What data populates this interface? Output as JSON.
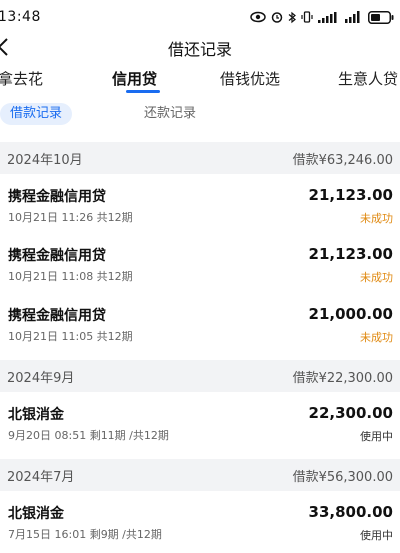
{
  "status_bar": {
    "time": "13:48"
  },
  "nav": {
    "title": "借还记录"
  },
  "product_tabs": [
    {
      "label": "拿去花"
    },
    {
      "label": "信用贷"
    },
    {
      "label": "借钱优选"
    },
    {
      "label": "生意人贷"
    }
  ],
  "subtabs": [
    {
      "label": "借款记录"
    },
    {
      "label": "还款记录"
    }
  ],
  "groups": [
    {
      "month": "2024年10月",
      "total": "借款¥63,246.00",
      "items": [
        {
          "name": "携程金融信用贷",
          "meta": "10月21日 11:26 共12期",
          "amount": "21,123.00",
          "status": "未成功"
        },
        {
          "name": "携程金融信用贷",
          "meta": "10月21日 11:08 共12期",
          "amount": "21,123.00",
          "status": "未成功"
        },
        {
          "name": "携程金融信用贷",
          "meta": "10月21日 11:05 共12期",
          "amount": "21,000.00",
          "status": "未成功"
        }
      ]
    },
    {
      "month": "2024年9月",
      "total": "借款¥22,300.00",
      "items": [
        {
          "name": "北银消金",
          "meta": "9月20日 08:51 剩11期 /共12期",
          "amount": "22,300.00",
          "status": "使用中"
        }
      ]
    },
    {
      "month": "2024年7月",
      "total": "借款¥56,300.00",
      "items": [
        {
          "name": "北银消金",
          "meta": "7月15日 16:01 剩9期 /共12期",
          "amount": "33,800.00",
          "status": "使用中"
        }
      ]
    }
  ],
  "colors": {
    "accent": "#1a6cf0",
    "warning": "#e08a12",
    "section_bg": "#f2f3f5"
  }
}
